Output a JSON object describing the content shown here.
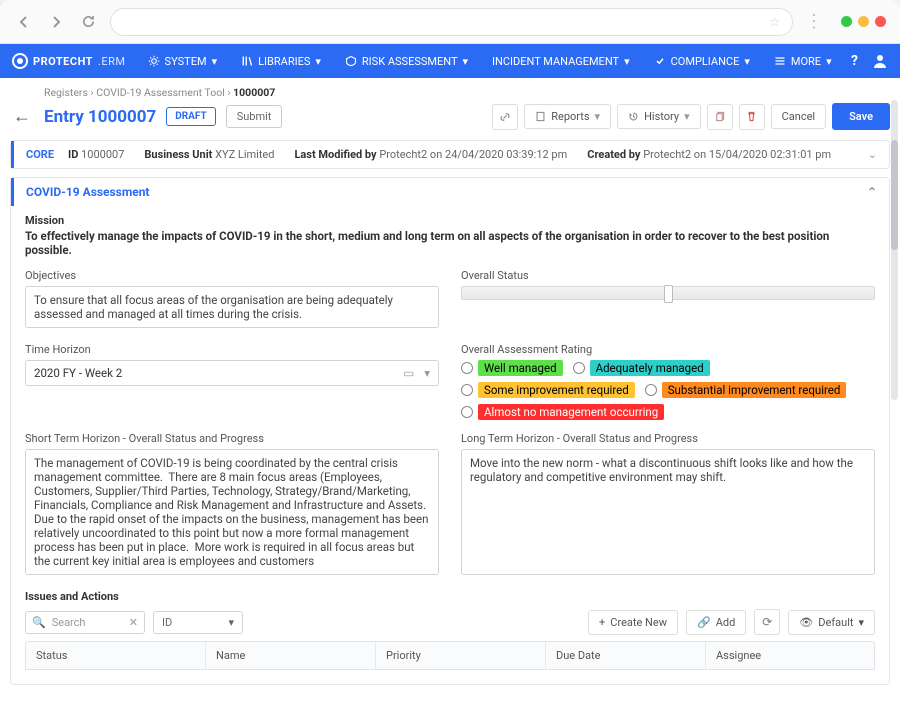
{
  "brand": {
    "name": "PROTECHT",
    "sub": ".ERM"
  },
  "nav": {
    "system": "SYSTEM",
    "libraries": "LIBRARIES",
    "risk": "RISK ASSESSMENT",
    "incident": "INCIDENT MANAGEMENT",
    "compliance": "COMPLIANCE",
    "more": "MORE"
  },
  "breadcrumb": {
    "a": "Registers",
    "b": "COVID-19 Assessment Tool",
    "c": "1000007"
  },
  "page": {
    "title": "Entry 1000007",
    "draft": "DRAFT",
    "submit": "Submit"
  },
  "actions": {
    "reports": "Reports",
    "history": "History",
    "cancel": "Cancel",
    "save": "Save"
  },
  "core": {
    "label": "CORE",
    "id_lbl": "ID",
    "id": "1000007",
    "bu_lbl": "Business Unit",
    "bu": "XYZ Limited",
    "mod_lbl": "Last Modified by",
    "mod": "Protecht2 on 24/04/2020 03:39:12 pm",
    "cre_lbl": "Created by",
    "cre": "Protecht2 on 15/04/2020 02:31:01 pm"
  },
  "assessment": {
    "title": "COVID-19 Assessment",
    "mission_lbl": "Mission",
    "mission": "To effectively manage the impacts of COVID-19 in the short, medium and long term on all aspects of the organisation in order to recover to the best position possible.",
    "objectives_lbl": "Objectives",
    "objectives": "To ensure that all focus areas of the organisation are being adequately assessed and managed at all times during the crisis.",
    "status_lbl": "Overall Status",
    "time_lbl": "Time Horizon",
    "time": "2020 FY - Week 2",
    "rating_lbl": "Overall Assessment Rating",
    "ratings": {
      "r1": "Well managed",
      "r2": "Adequately managed",
      "r3": "Some improvement required",
      "r4": "Substantial improvement required",
      "r5": "Almost no management occurring"
    },
    "short_lbl": "Short Term Horizon - Overall Status and Progress",
    "short": "The management of COVID-19 is being coordinated by the central crisis management committee.  There are 8 main focus areas (Employees, Customers, Supplier/Third Parties, Technology, Strategy/Brand/Marketing, Financials, Compliance and Risk Management and Infrastructure and Assets. Due to the rapid onset of the impacts on the business, management has been relatively uncoordinated to this point but now a more formal management process has been put in place.  More work is required in all focus areas but the current key initial area is employees and customers",
    "long_lbl": "Long Term Horizon - Overall Status and Progress",
    "long": "Move into the new norm - what a discontinuous shift looks like and how the regulatory and competitive environment may shift."
  },
  "issues": {
    "title": "Issues and Actions",
    "search": "Search",
    "id": "ID",
    "create": "Create New",
    "add": "Add",
    "default": "Default",
    "cols": {
      "status": "Status",
      "name": "Name",
      "priority": "Priority",
      "due": "Due Date",
      "assignee": "Assignee"
    }
  },
  "colors": {
    "green": "#5de04a",
    "cyan": "#2cd0c8",
    "yellow": "#ffc233",
    "orange": "#ff8a1f",
    "red": "#ff2f2f"
  }
}
